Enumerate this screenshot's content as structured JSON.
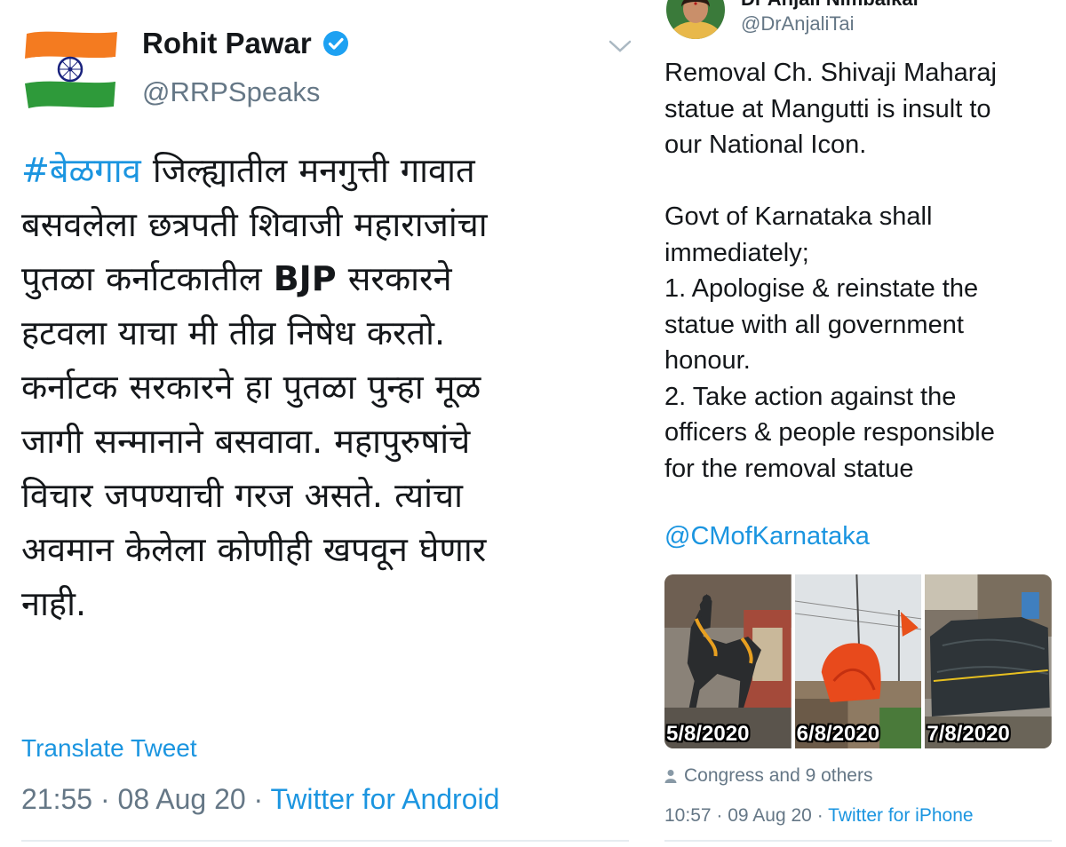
{
  "left_tweet": {
    "author_name": "Rohit Pawar",
    "handle": "@RRPSpeaks",
    "avatar_icon": "india-flag-avatar",
    "text_lines": {
      "l1_hashtag": "#बेळगाव",
      "l1_rest": " जिल्ह्यातील मनगुत्ती गावात",
      "l2": "बसवलेला छत्रपती शिवाजी महाराजांचा",
      "l3_pre": "पुतळा कर्नाटकातील ",
      "l3_bold": "BJP",
      "l3_post": " सरकारने",
      "l4": "हटवला याचा मी तीव्र निषेध करतो.",
      "l5": "कर्नाटक सरकारने हा पुतळा पुन्हा मूळ",
      "l6": "जागी सन्मानाने बसवावा. महापुरुषांचे",
      "l7": "विचार जपण्याची गरज असते. त्यांचा",
      "l8": "अवमान केलेला कोणीही खपवून घेणार",
      "l9": "नाही."
    },
    "translate_label": "Translate Tweet",
    "time": "21:55",
    "date": "08 Aug 20",
    "source": "Twitter for Android",
    "separator": "·"
  },
  "right_tweet": {
    "name_cut": "Dr Anjali Nimbalkar",
    "handle": "@DrAnjaliTai",
    "text": {
      "p1a": "Removal Ch. Shivaji Maharaj",
      "p1b": "statue at Mangutti is insult to",
      "p1c": "our National Icon.",
      "p2a": "Govt of Karnataka shall",
      "p2b": "immediately;",
      "p2c": "1. Apologise & reinstate the",
      "p2d": "statue with all government",
      "p2e": "honour.",
      "p2f": "2. Take action against the",
      "p2g": "officers & people responsible",
      "p2h": "for the removal statue"
    },
    "mention": "@CMofKarnataka",
    "photos": [
      {
        "date": "5/8/2020"
      },
      {
        "date": "6/8/2020"
      },
      {
        "date": "7/8/2020"
      }
    ],
    "social_context": "Congress and 9 others",
    "time": "10:57",
    "date": "09 Aug 20",
    "source": "Twitter for iPhone",
    "separator": "·"
  },
  "colors": {
    "link": "#1b95e0",
    "muted": "#657786",
    "text": "#14171a",
    "verified": "#1da1f2"
  }
}
